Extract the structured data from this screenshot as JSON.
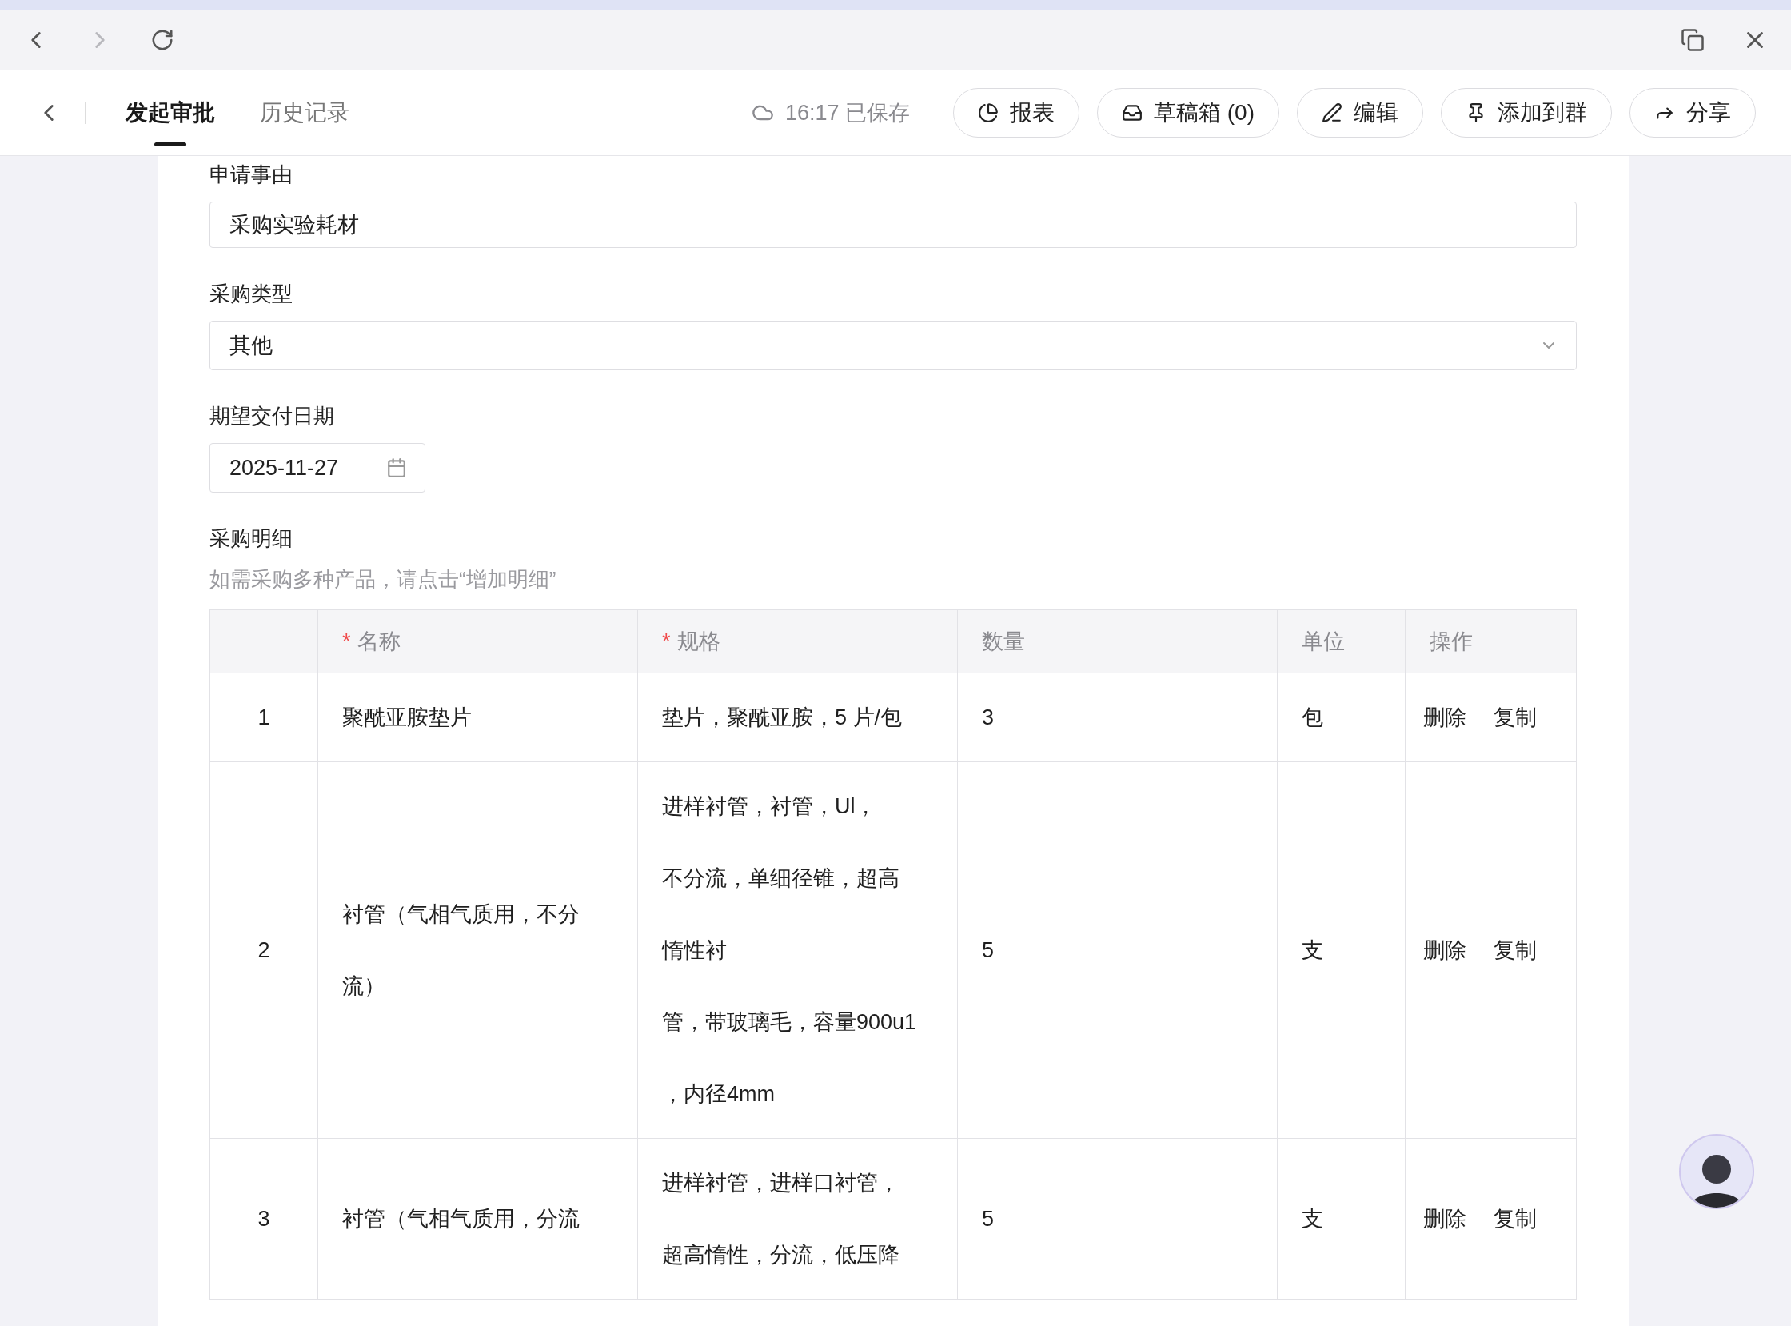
{
  "header": {
    "tabs": [
      {
        "label": "发起审批",
        "selected": true
      },
      {
        "label": "历史记录",
        "selected": false
      }
    ],
    "save_status": "16:17 已保存",
    "actions": [
      "报表",
      "草稿箱 (0)",
      "编辑",
      "添加到群",
      "分享"
    ]
  },
  "form": {
    "fields": [
      {
        "kind": "text",
        "label": "申请事由",
        "value": "采购实验耗材"
      },
      {
        "kind": "select",
        "label": "采购类型",
        "value": "其他"
      },
      {
        "kind": "date",
        "label": "期望交付日期",
        "value": "2025-11-27"
      }
    ],
    "details": {
      "label": "采购明细",
      "hint": "如需采购多种产品，请点击“增加明细”",
      "columns": [
        {
          "label": "名称",
          "mark": "*"
        },
        {
          "label": "规格",
          "mark": "*"
        },
        {
          "label": "数量"
        },
        {
          "label": "单位"
        },
        {
          "label": "操作"
        }
      ],
      "rows": [
        {
          "index": "1",
          "name": [
            "聚酰亚胺垫片"
          ],
          "spec": [
            "垫片，聚酰亚胺，5 片/包"
          ],
          "quantity": "3",
          "unit": "包",
          "actions": [
            "删除",
            "复制"
          ]
        },
        {
          "index": "2",
          "name": [
            "衬管（气相气质用，不分",
            "流）"
          ],
          "spec": [
            "进样衬管，衬管，Ul，",
            "不分流，单细径锥，超高",
            "惰性衬",
            "管，带玻璃毛，容量900u1",
            "，内径4mm"
          ],
          "quantity": "5",
          "unit": "支",
          "actions": [
            "删除",
            "复制"
          ]
        },
        {
          "index": "3",
          "name": [
            "衬管（气相气质用，分流"
          ],
          "spec": [
            "进样衬管，进样口衬管，",
            "超高惰性，分流，低压降"
          ],
          "quantity": "5",
          "unit": "支",
          "actions": [
            "删除",
            "复制"
          ]
        }
      ]
    }
  }
}
